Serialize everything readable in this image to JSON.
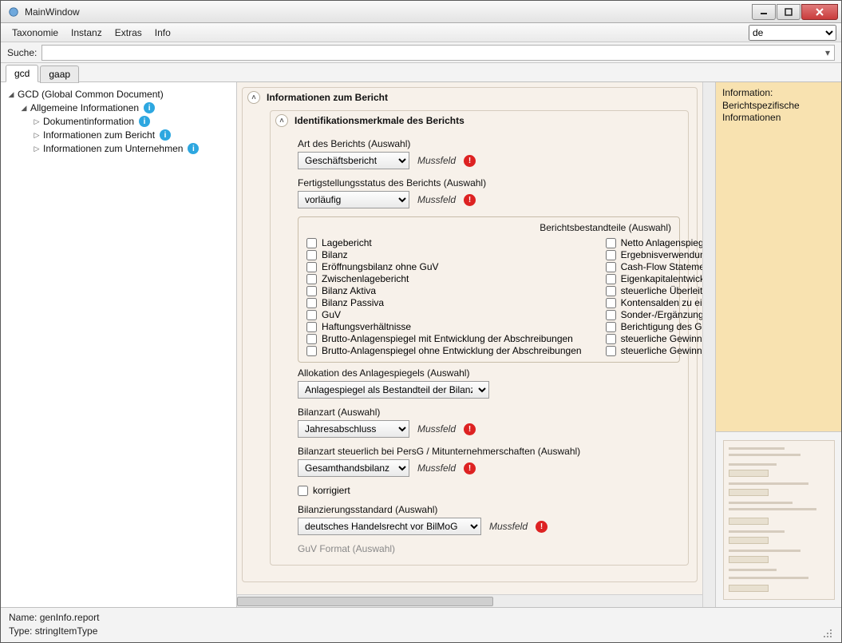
{
  "window": {
    "title": "MainWindow"
  },
  "menubar": {
    "items": [
      "Taxonomie",
      "Instanz",
      "Extras",
      "Info"
    ],
    "lang_selected": "de"
  },
  "search": {
    "label": "Suche:",
    "value": ""
  },
  "tabs": {
    "items": [
      "gcd",
      "gaap"
    ],
    "active": 0
  },
  "tree": {
    "root": "GCD (Global Common Document)",
    "n1": "Allgemeine Informationen",
    "n1a": "Dokumentinformation",
    "n1b": "Informationen zum Bericht",
    "n1c": "Informationen zum Unternehmen"
  },
  "sections": {
    "outer_title": "Informationen zum Bericht",
    "inner_title": "Identifikationsmerkmale des Berichts"
  },
  "fields": {
    "art": {
      "label": "Art des Berichts (Auswahl)",
      "value": "Geschäftsbericht"
    },
    "status": {
      "label": "Fertigstellungsstatus des Berichts (Auswahl)",
      "value": "vorläufig"
    },
    "group_title": "Berichtsbestandteile (Auswahl)",
    "cb_left": [
      "Lagebericht",
      "Bilanz",
      "Eröffnungsbilanz ohne GuV",
      "Zwischenlagebericht",
      "Bilanz Aktiva",
      "Bilanz Passiva",
      "GuV",
      "Haftungsverhältnisse",
      "Brutto-Anlagenspiegel mit Entwicklung der Abschreibungen",
      "Brutto-Anlagenspiegel ohne Entwicklung der Abschreibungen"
    ],
    "cb_right": [
      "Netto Anlagenspiegel",
      "Ergebnisverwendung",
      "Cash-Flow Statement",
      "Eigenkapitalentwicklung",
      "steuerliche Überleitungsrechnung",
      "Kontensalden zu einer oder mehre",
      "Sonder-/Ergänzungsbilanzen als Fr",
      "Berichtigung des Gewinns bei Wec",
      "steuerliche Gewinnermittlung",
      "steuerliche Gewinnermittlung bei P"
    ],
    "allok": {
      "label": "Allokation des Anlagespiegels (Auswahl)",
      "value": "Anlagespiegel als Bestandteil der Bilanz"
    },
    "bilanzart": {
      "label": "Bilanzart (Auswahl)",
      "value": "Jahresabschluss"
    },
    "bilanzart_st": {
      "label": "Bilanzart steuerlich bei PersG / Mitunternehmerschaften (Auswahl)",
      "value": "Gesamthandsbilanz"
    },
    "korr": {
      "label": "korrigiert"
    },
    "std": {
      "label": "Bilanzierungsstandard (Auswahl)",
      "value": "deutsches Handelsrecht vor BilMoG"
    },
    "guv_truncated": "GuV Format (Auswahl)",
    "muss": "Mussfeld"
  },
  "info_panel": {
    "line1": "Information:",
    "line2": "Berichtspezifische",
    "line3": "Informationen"
  },
  "status": {
    "name_label": "Name:",
    "name_value": "genInfo.report",
    "type_label": "Type:",
    "type_value": "stringItemType"
  }
}
